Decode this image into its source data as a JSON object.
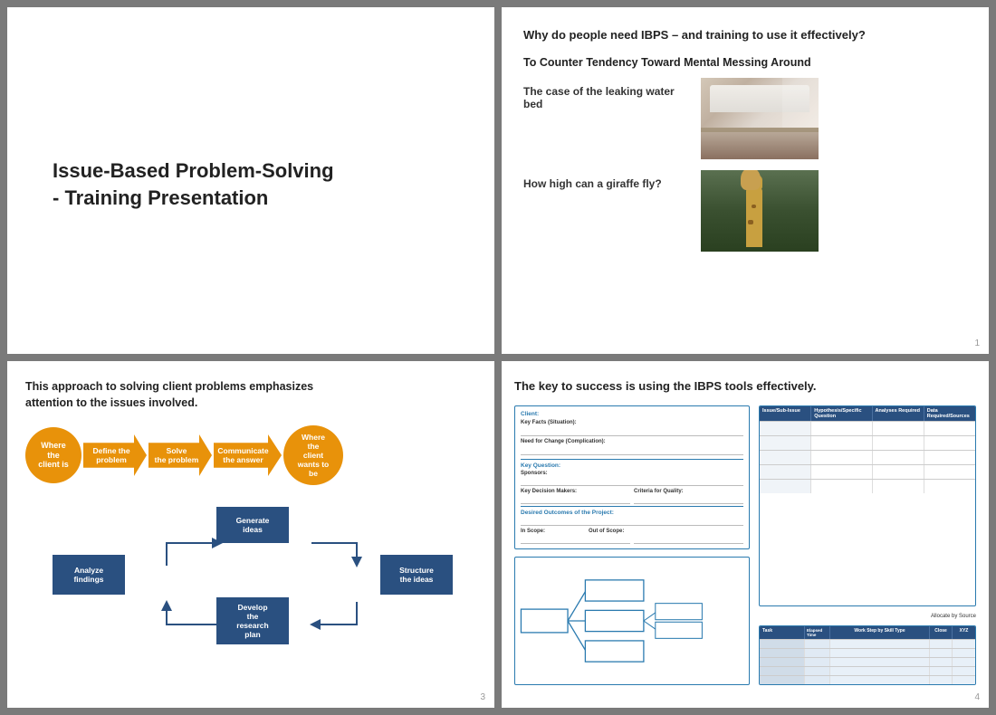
{
  "slide1": {
    "title_line1": "Issue-Based Problem-Solving",
    "title_line2": "- Training Presentation"
  },
  "slide2": {
    "question": "Why do people need IBPS – and training to use it effectively?",
    "counter_title": "To Counter Tendency Toward Mental Messing Around",
    "case1_text": "The case of the leaking water bed",
    "case2_text": "How high can a giraffe fly?",
    "slide_number": "1"
  },
  "slide3": {
    "title_line1": "This approach to solving client problems emphasizes",
    "title_line2": "attention to the issues involved.",
    "flow_items": [
      {
        "label": "Where\nthe\nclient is",
        "type": "circle"
      },
      {
        "label": "Define the\nproblem",
        "type": "arrow"
      },
      {
        "label": "Solve\nthe problem",
        "type": "arrow"
      },
      {
        "label": "Communicate\nthe answer",
        "type": "arrow"
      },
      {
        "label": "Where\nthe\nclient\nwants to\nbe",
        "type": "circle"
      }
    ],
    "cycle_items": [
      {
        "label": "Generate\nideas",
        "pos": "top"
      },
      {
        "label": "Structure\nthe ideas",
        "pos": "right"
      },
      {
        "label": "Develop\nthe\nresearch\nplan",
        "pos": "bottom"
      },
      {
        "label": "Analyze\nfindings",
        "pos": "left"
      }
    ],
    "slide_number": "3"
  },
  "slide4": {
    "title": "The key to success is using the IBPS tools effectively.",
    "slide_number": "4",
    "form_labels": {
      "client": "Client:",
      "key_facts": "Key Facts (Situation):",
      "need_for_change": "Need for Change (Complication):",
      "key_question": "Key Question:",
      "sponsors": "Sponsors:",
      "key_decision": "Key Decision Makers:",
      "criteria": "Criteria for Quality:",
      "desired_outcomes": "Desired Outcomes of the Project:",
      "in_scope": "In Scope:",
      "out_scope": "Out of Scope:"
    },
    "table_headers": [
      "Issue/Sub-Issue",
      "Hypothesis/Specific Question",
      "Analyses Required",
      "Data Required/Sources"
    ],
    "work_headers": [
      "Task",
      "Elapsed Time",
      "Work Step by Skill Type",
      "Close",
      "XYZ"
    ]
  }
}
